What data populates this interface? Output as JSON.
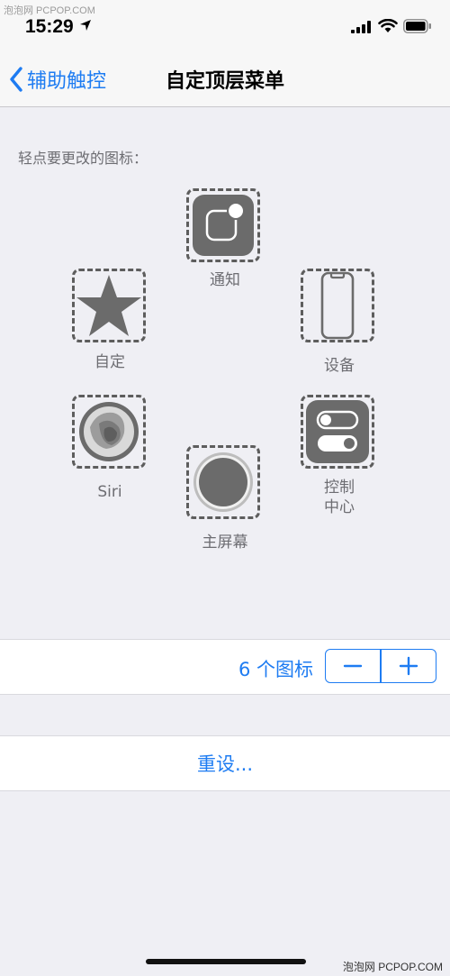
{
  "status": {
    "time": "15:29",
    "watermark": "泡泡网 PCPOP.COM"
  },
  "nav": {
    "back_label": "辅助触控",
    "title": "自定顶层菜单"
  },
  "instruction": "轻点要更改的图标：",
  "slots": [
    {
      "label": "通知",
      "icon": "notification-icon"
    },
    {
      "label": "自定",
      "icon": "star-icon"
    },
    {
      "label": "设备",
      "icon": "device-icon"
    },
    {
      "label": "Siri",
      "icon": "siri-icon"
    },
    {
      "label": "控制\n中心",
      "icon": "control-center-icon"
    },
    {
      "label": "主屏幕",
      "icon": "home-icon"
    }
  ],
  "count": {
    "label": "6 个图标",
    "minus": "−",
    "plus": "+"
  },
  "reset": {
    "label": "重设..."
  },
  "footer": {
    "watermark": "泡泡网 PCPOP.COM"
  },
  "colors": {
    "accent": "#1e7cf2",
    "icon_gray": "#6b6b6b",
    "background": "#efeff4"
  }
}
